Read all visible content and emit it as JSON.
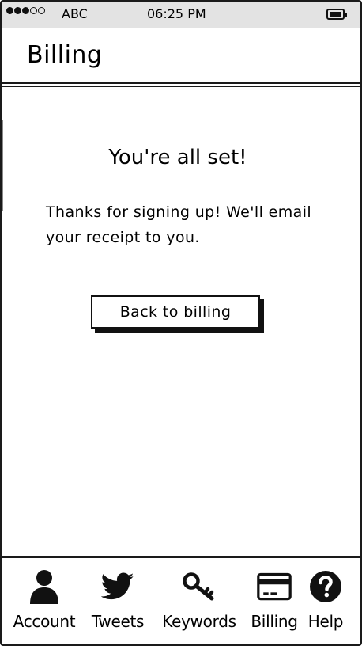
{
  "status_bar": {
    "carrier": "ABC",
    "time": "06:25 PM",
    "signal_icon": "signal-dots-icon",
    "battery_icon": "battery-icon"
  },
  "header": {
    "title": "Billing"
  },
  "main": {
    "headline": "You're all set!",
    "message": "Thanks for signing up! We'll email your receipt to you.",
    "back_button_label": "Back to billing"
  },
  "tab_bar": {
    "items": [
      {
        "label": "Account",
        "icon": "person-icon"
      },
      {
        "label": "Tweets",
        "icon": "twitter-bird-icon"
      },
      {
        "label": "Keywords",
        "icon": "key-icon"
      },
      {
        "label": "Billing",
        "icon": "credit-card-icon"
      },
      {
        "label": "Help",
        "icon": "question-circle-icon"
      }
    ]
  },
  "colors": {
    "status_bar_bg": "#e3e3e3",
    "ink": "#000000",
    "background": "#ffffff"
  }
}
